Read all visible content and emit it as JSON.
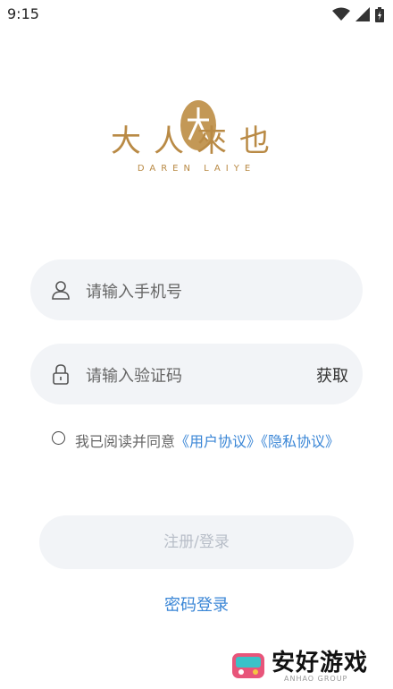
{
  "status_bar": {
    "time": "9:15"
  },
  "logo": {
    "title": "大人來也",
    "subtitle": "DAREN LAIYE"
  },
  "phone_field": {
    "placeholder": "请输入手机号"
  },
  "code_field": {
    "placeholder": "请输入验证码",
    "action_label": "获取"
  },
  "agreement": {
    "prefix": "我已阅读并同意",
    "user_agreement": "《用户协议》",
    "privacy_policy": "《隐私协议》",
    "checked": false
  },
  "login_button": {
    "label": "注册/登录"
  },
  "password_login_link": {
    "label": "密码登录"
  },
  "watermark": {
    "text": "安好游戏",
    "subtext": "ANHAO GROUP"
  },
  "colors": {
    "accent_link": "#3a86d6",
    "brand_gold": "#b98a45",
    "field_bg": "#f2f4f7"
  }
}
